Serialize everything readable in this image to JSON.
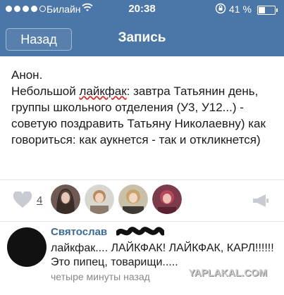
{
  "status_bar": {
    "carrier": "Билайн",
    "time": "20:38",
    "battery": "41 %",
    "battery_level": 0.41,
    "signal_bars": 5,
    "signal_filled": 4
  },
  "nav": {
    "back_label": "Назад",
    "title": "Запись"
  },
  "post": {
    "line1": "Анон.",
    "line2_prefix": "Небольшой ",
    "line2_highlight": "лайкфак",
    "line2_rest": ": завтра Татьянин день, группы школьного отделения (У3, У12...) - советую поздравить Татьяну Николаевну) как говориться: как аукнется - так и откликнется)"
  },
  "actions": {
    "like_count": "4",
    "liker_avatars": [
      "avatar-1",
      "avatar-2",
      "avatar-3",
      "avatar-4"
    ]
  },
  "comment": {
    "author": "Святослав",
    "text": "лайкфак.... ЛАЙКФАК! ЛАЙКФАК, КАРЛ!!!!!! Это пипец, товарищи.....",
    "time": "четыре минуты назад"
  },
  "watermark": "YAPLAKAL.COM",
  "colors": {
    "accent": "#4a76a8",
    "author": "#3a6b99",
    "underline": "#dd2222"
  }
}
